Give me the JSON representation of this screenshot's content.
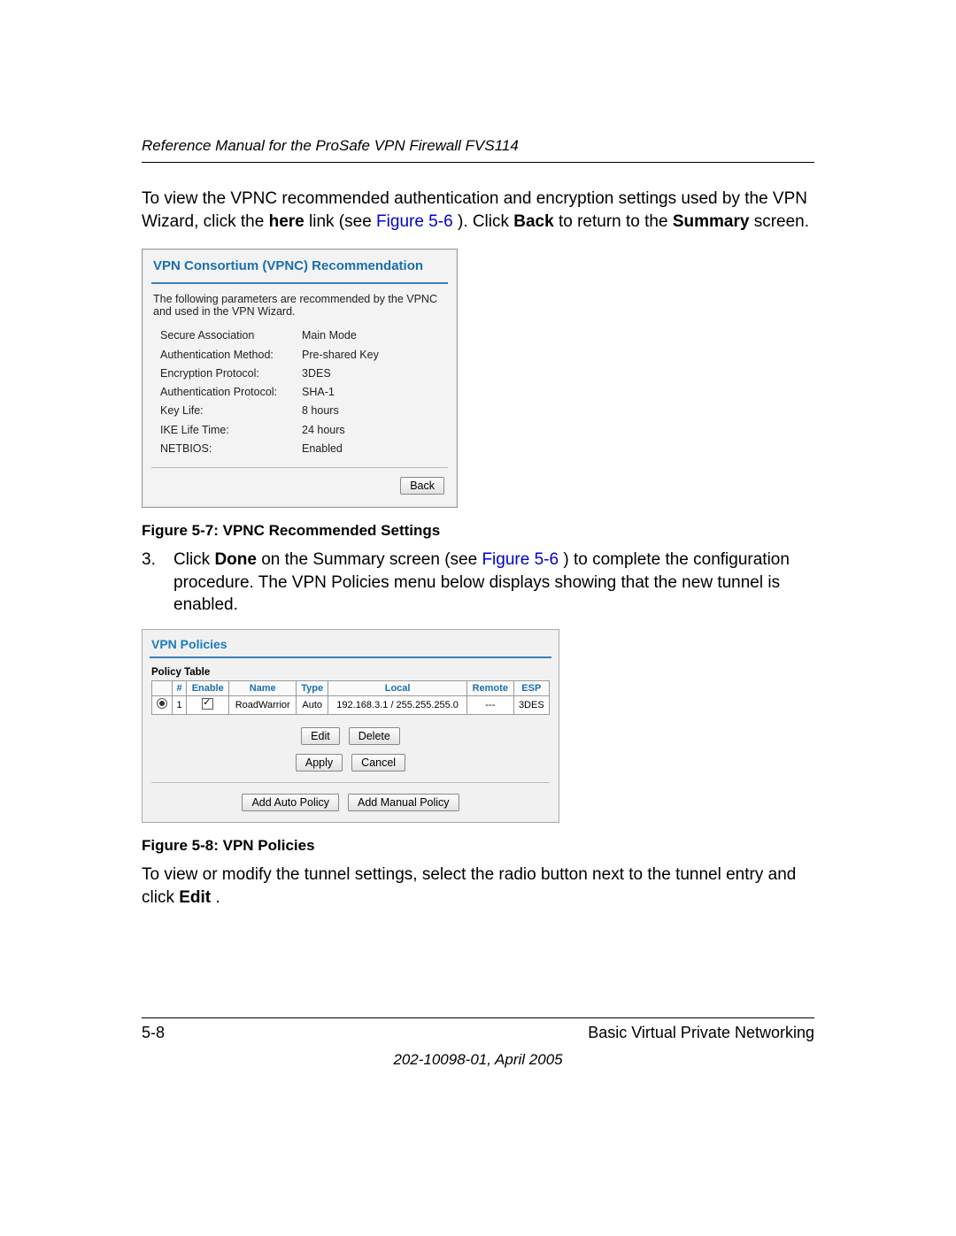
{
  "header": {
    "title": "Reference Manual for the ProSafe VPN Firewall FVS114"
  },
  "intro": {
    "p1a": "To view the VPNC recommended authentication and encryption settings used by the VPN Wizard, click the ",
    "here": "here",
    "p1b": " link (see ",
    "figref1": "Figure 5-6",
    "p1c": "). Click ",
    "back": "Back",
    "p1d": " to return to the ",
    "summary": "Summary",
    "p1e": " screen."
  },
  "vpnc": {
    "title": "VPN Consortium (VPNC) Recommendation",
    "desc": "The following parameters are recommended by the VPNC and used in the VPN Wizard.",
    "rows": [
      {
        "k": "Secure Association",
        "v": "Main Mode"
      },
      {
        "k": "Authentication Method:",
        "v": "Pre-shared Key"
      },
      {
        "k": "Encryption Protocol:",
        "v": "3DES"
      },
      {
        "k": "Authentication Protocol:",
        "v": "SHA-1"
      },
      {
        "k": "Key Life:",
        "v": "8 hours"
      },
      {
        "k": "IKE Life Time:",
        "v": "24 hours"
      },
      {
        "k": "NETBIOS:",
        "v": "Enabled"
      }
    ],
    "back_btn": "Back"
  },
  "fig1_caption": "Figure 5-7:  VPNC Recommended Settings",
  "step3": {
    "n": "3.",
    "a": "Click ",
    "done": "Done",
    "b": " on the Summary screen (see ",
    "figref": "Figure 5-6",
    "c": ") to complete the configuration procedure. The VPN Policies menu below displays showing that the new tunnel is enabled."
  },
  "policies": {
    "title": "VPN Policies",
    "subtitle": "Policy Table",
    "headers": [
      "",
      "#",
      "Enable",
      "Name",
      "Type",
      "Local",
      "Remote",
      "ESP"
    ],
    "row": {
      "num": "1",
      "name": "RoadWarrior",
      "type": "Auto",
      "local": "192.168.3.1 / 255.255.255.0",
      "remote": "---",
      "esp": "3DES"
    },
    "btn_edit": "Edit",
    "btn_delete": "Delete",
    "btn_apply": "Apply",
    "btn_cancel": "Cancel",
    "btn_add_auto": "Add Auto Policy",
    "btn_add_manual": "Add Manual Policy"
  },
  "fig2_caption": "Figure 5-8:  VPN Policies",
  "tail": {
    "a": "To view or modify the tunnel settings, select the radio button next to the tunnel entry and click ",
    "edit": "Edit",
    "b": "."
  },
  "footer": {
    "page": "5-8",
    "section": "Basic Virtual Private Networking",
    "docid": "202-10098-01, April 2005"
  }
}
